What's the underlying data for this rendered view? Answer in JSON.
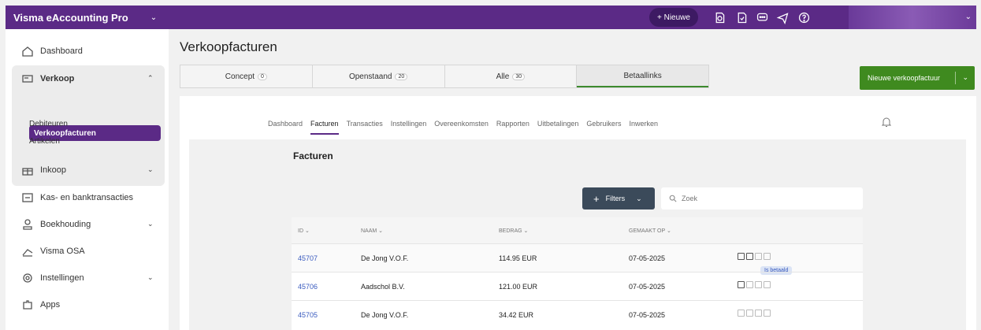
{
  "topbar": {
    "app_title": "Visma eAccounting Pro",
    "new_button": "+ Nieuwe",
    "icons": [
      "receipt-icon",
      "receipt-check-icon",
      "chat-icon",
      "megaphone-icon",
      "help-icon"
    ]
  },
  "sidebar": {
    "items": [
      {
        "label": "Dashboard",
        "icon": "home-icon"
      },
      {
        "label": "Verkoop",
        "icon": "invoice-icon",
        "expanded": true
      },
      {
        "label": "Inkoop",
        "icon": "gift-icon"
      },
      {
        "label": "Kas- en banktransacties",
        "icon": "bank-icon"
      },
      {
        "label": "Boekhouding",
        "icon": "accounting-icon"
      },
      {
        "label": "Visma OSA",
        "icon": "chart-icon"
      },
      {
        "label": "Instellingen",
        "icon": "gear-icon"
      },
      {
        "label": "Apps",
        "icon": "puzzle-icon"
      }
    ],
    "verkoop_sub": [
      "Verkoopfacturen",
      "Debiteuren",
      "Artikelen"
    ]
  },
  "main": {
    "page_title": "Verkoopfacturen",
    "tabs": [
      {
        "label": "Concept",
        "count": "0"
      },
      {
        "label": "Openstaand",
        "count": "20"
      },
      {
        "label": "Alle",
        "count": "30"
      },
      {
        "label": "Betaallinks",
        "count": ""
      }
    ],
    "new_invoice_button": "Nieuwe verkoopfactuur",
    "subnav": [
      "Dashboard",
      "Facturen",
      "Transacties",
      "Instellingen",
      "Overeenkomsten",
      "Rapporten",
      "Uitbetalingen",
      "Gebruikers",
      "Inwerken"
    ],
    "section_title": "Facturen",
    "filters_label": "Filters",
    "search_placeholder": "Zoek",
    "table": {
      "headers": [
        "ID ⌄",
        "NAAM ⌄",
        "BEDRAG ⌄",
        "GEMAAKT OP ⌄"
      ],
      "rows": [
        {
          "id": "45707",
          "name": "De Jong V.O.F.",
          "amount": "114.95 EUR",
          "date": "07-05-2025"
        },
        {
          "id": "45706",
          "name": "Aadschol B.V.",
          "amount": "121.00 EUR",
          "date": "07-05-2025"
        },
        {
          "id": "45705",
          "name": "De Jong V.O.F.",
          "amount": "34.42 EUR",
          "date": "07-05-2025"
        }
      ]
    },
    "tooltip": "Is betaald"
  },
  "colors": {
    "brand_purple": "#5b2a86",
    "green": "#3f8a1f",
    "link_blue": "#3a5bbf"
  }
}
